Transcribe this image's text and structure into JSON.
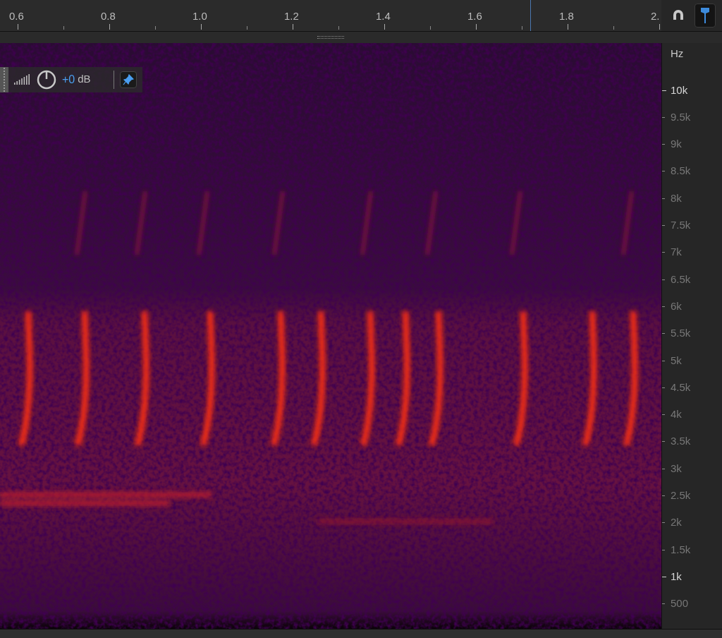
{
  "ruler": {
    "labels": [
      "0.6",
      "0.8",
      "1.0",
      "1.2",
      "1.4",
      "1.6",
      "1.8",
      "2."
    ],
    "playhead": true
  },
  "toolbar": [
    {
      "kind": "magnet",
      "selected": false
    },
    {
      "kind": "marker",
      "selected": true
    }
  ],
  "hud": {
    "gain": "+0",
    "unit": "dB",
    "pinned": true
  },
  "frequency_axis": {
    "unit": "Hz",
    "labels": [
      {
        "text": "10k",
        "major": true
      },
      {
        "text": "9.5k",
        "major": false
      },
      {
        "text": "9k",
        "major": false
      },
      {
        "text": "8.5k",
        "major": false
      },
      {
        "text": "8k",
        "major": false
      },
      {
        "text": "7.5k",
        "major": false
      },
      {
        "text": "7k",
        "major": false
      },
      {
        "text": "6.5k",
        "major": false
      },
      {
        "text": "6k",
        "major": false
      },
      {
        "text": "5.5k",
        "major": false
      },
      {
        "text": "5k",
        "major": false
      },
      {
        "text": "4.5k",
        "major": false
      },
      {
        "text": "4k",
        "major": false
      },
      {
        "text": "3.5k",
        "major": false
      },
      {
        "text": "3k",
        "major": false
      },
      {
        "text": "2.5k",
        "major": false
      },
      {
        "text": "2k",
        "major": false
      },
      {
        "text": "1.5k",
        "major": false
      },
      {
        "text": "1k",
        "major": true
      },
      {
        "text": "500",
        "major": false
      }
    ]
  }
}
